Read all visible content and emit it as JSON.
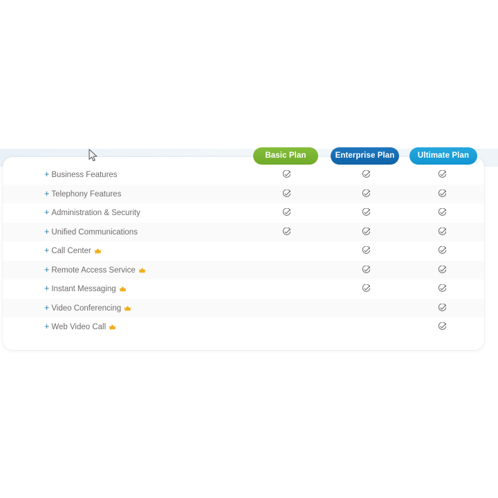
{
  "colors": {
    "basic_plan": "#6faa29",
    "enterprise_plan": "#0f63a8",
    "ultimate_plan": "#1295d2",
    "crown": "#f0ae1a",
    "plus": "#2a7ea8",
    "feature_text": "#6d6d6d",
    "check": "#5a5a5a",
    "band": "#eef4f8",
    "row_alt": "#fafafa",
    "card": "#ffffff"
  },
  "plans": [
    {
      "id": "basic",
      "label": "Basic Plan",
      "icon": "plan-pill"
    },
    {
      "id": "enterprise",
      "label": "Enterprise Plan",
      "icon": "plan-pill"
    },
    {
      "id": "ultimate",
      "label": "Ultimate Plan",
      "icon": "plan-pill"
    }
  ],
  "features": [
    {
      "expander": "+",
      "label": "Business Features",
      "crown": false,
      "crown_icon": "crown-icon",
      "checks": [
        true,
        true,
        true
      ]
    },
    {
      "expander": "+",
      "label": "Telephony Features",
      "crown": false,
      "crown_icon": "crown-icon",
      "checks": [
        true,
        true,
        true
      ]
    },
    {
      "expander": "+",
      "label": "Administration & Security",
      "crown": false,
      "crown_icon": "crown-icon",
      "checks": [
        true,
        true,
        true
      ]
    },
    {
      "expander": "+",
      "label": "Unified Communications",
      "crown": false,
      "crown_icon": "crown-icon",
      "checks": [
        true,
        true,
        true
      ]
    },
    {
      "expander": "+",
      "label": "Call Center",
      "crown": true,
      "crown_icon": "crown-icon",
      "checks": [
        false,
        true,
        true
      ]
    },
    {
      "expander": "+",
      "label": "Remote Access Service",
      "crown": true,
      "crown_icon": "crown-icon",
      "checks": [
        false,
        true,
        true
      ]
    },
    {
      "expander": "+",
      "label": "Instant Messaging",
      "crown": true,
      "crown_icon": "crown-icon",
      "checks": [
        false,
        true,
        true
      ]
    },
    {
      "expander": "+",
      "label": "Video Conferencing",
      "crown": true,
      "crown_icon": "crown-icon",
      "checks": [
        false,
        false,
        true
      ]
    },
    {
      "expander": "+",
      "label": "Web Video Call",
      "crown": true,
      "crown_icon": "crown-icon",
      "checks": [
        false,
        false,
        true
      ]
    }
  ],
  "icons": {
    "check": "circle-check-icon",
    "crown": "crown-icon",
    "cursor": "mouse-cursor-icon",
    "expander": "plus-expander-icon"
  }
}
